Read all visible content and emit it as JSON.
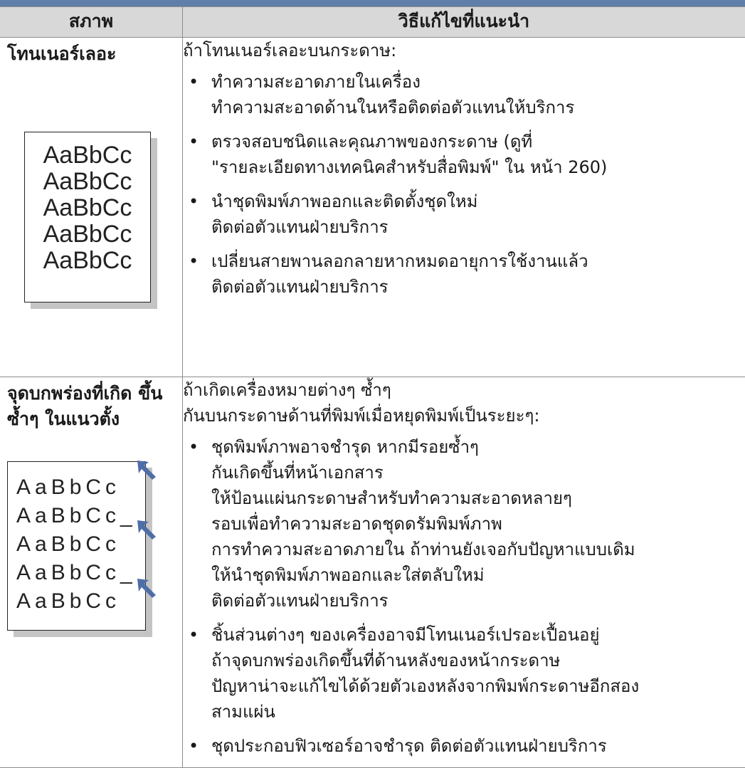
{
  "header": {
    "col1": "สภาพ",
    "col2": "วิธีแก้ไขที่แนะนำ"
  },
  "rows": [
    {
      "title_lines": [
        "โทนเนอร์เลอะ"
      ],
      "sample_lines": [
        "AaBbCc",
        "AaBbCc",
        "AaBbCc",
        "AaBbCc",
        "AaBbCc"
      ],
      "intro_lines": [
        "ถ้าโทนเนอร์เลอะบนกระดาษ:"
      ],
      "bullets": [
        [
          "ทำความสะอาดภายในเครื่อง",
          "ทำความสะอาดด้านในหรือติดต่อตัวแทนให้บริการ"
        ],
        [
          "ตรวจสอบชนิดและคุณภาพของกระดาษ (ดูที่",
          "\"รายละเอียดทางเทคนิคสำหรับสื่อพิมพ์\"  ใน หน้า 260)"
        ],
        [
          "นำชุดพิมพ์ภาพออกและติดตั้งชุดใหม่",
          "ติดต่อตัวแทนฝ่ายบริการ"
        ],
        [
          "เปลี่ยนสายพานลอกลายหากหมดอายุการใช้งานแล้ว",
          "ติดต่อตัวแทนฝ่ายบริการ"
        ]
      ]
    },
    {
      "title_lines": [
        "จุดบกพร่องที่เกิด",
        "ขึ้นซ้ำๆ ในแนวตั้ง"
      ],
      "sample_lines": [
        "AaBbCc",
        "AaBbCc_",
        "AaBbCc",
        "AaBbCc_",
        "AaBbCc"
      ],
      "intro_lines": [
        "ถ้าเกิดเครื่องหมายต่างๆ ซ้ำๆ",
        "กันบนกระดาษด้านที่พิมพ์เมื่อหยุดพิมพ์เป็นระยะๆ:"
      ],
      "bullets": [
        [
          "ชุดพิมพ์ภาพอาจชำรุด หากมีรอยซ้ำๆ",
          "กันเกิดขึ้นที่หน้าเอกสาร",
          "ให้ป้อนแผ่นกระดาษสำหรับทำความสะอาดหลายๆ",
          "รอบเพื่อทำความสะอาดชุดดรัมพิมพ์ภาพ",
          "การทำความสะอาดภายใน ถ้าท่านยังเจอกับปัญหาแบบเดิม",
          "ให้นำชุดพิมพ์ภาพออกและใส่ตลับใหม่",
          "ติดต่อตัวแทนฝ่ายบริการ"
        ],
        [
          "ชิ้นส่วนต่างๆ ของเครื่องอาจมีโทนเนอร์เปรอะเปื้อนอยู่",
          "ถ้าจุดบกพร่องเกิดขึ้นที่ด้านหลังของหน้ากระดาษ",
          "ปัญหาน่าจะแก้ไขได้ด้วยตัวเองหลังจากพิมพ์กระดาษอีกสอง",
          "สามแผ่น"
        ],
        [
          "ชุดประกอบฟิวเซอร์อาจชำรุด ติดต่อตัวแทนฝ่ายบริการ"
        ]
      ]
    }
  ],
  "colors": {
    "topbar": "#5f7fa8",
    "header_bg": "#d8d8d8",
    "arrow": "#4f6ea8"
  },
  "icons": {
    "arrow": "arrow-pointer-icon"
  }
}
